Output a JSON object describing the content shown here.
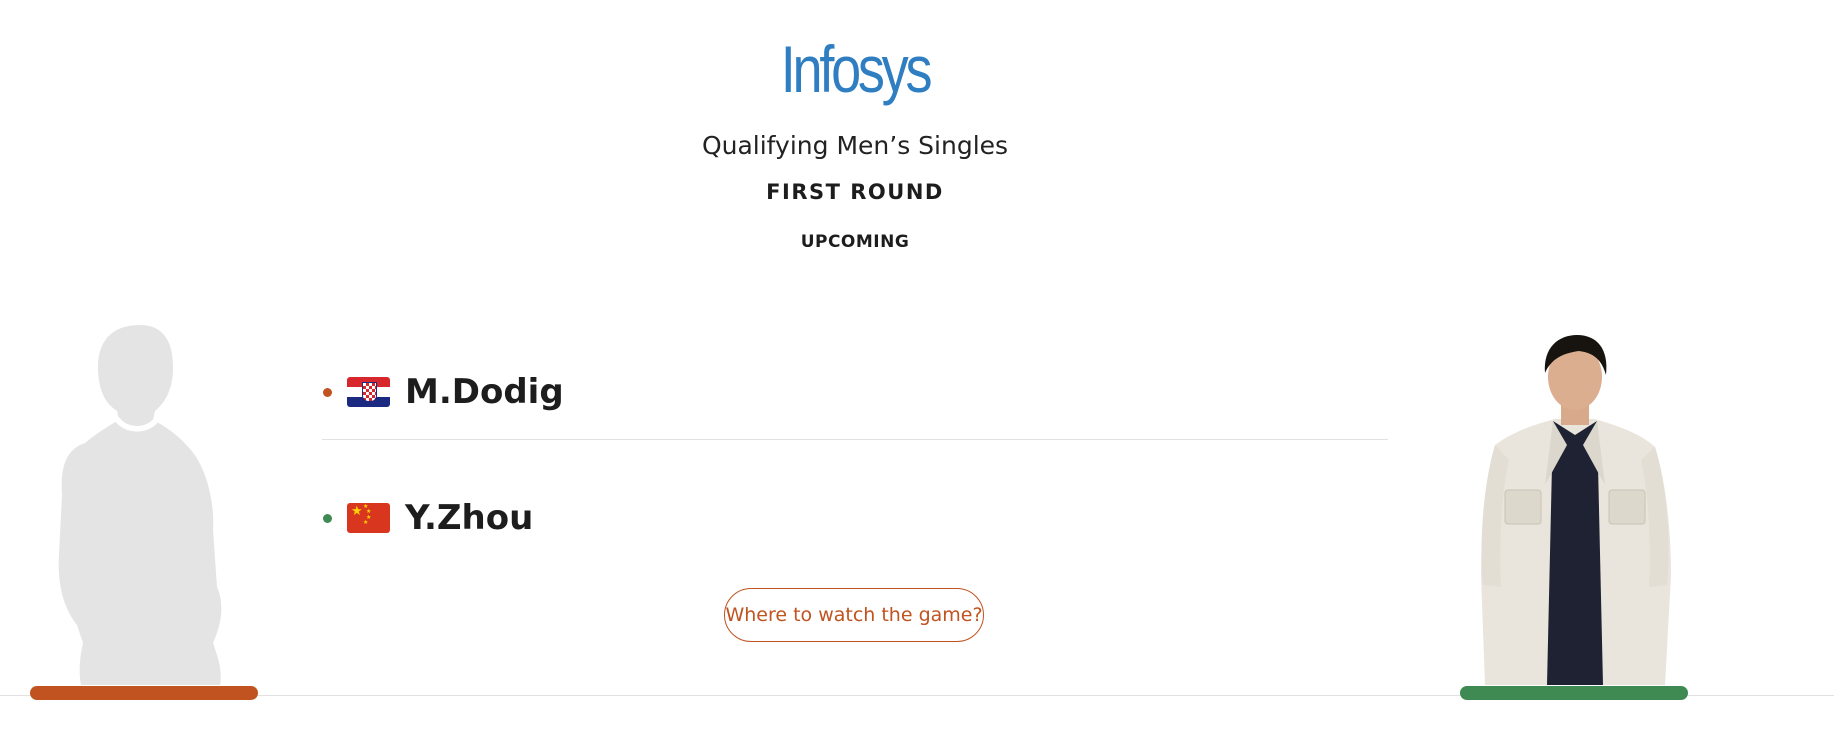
{
  "sponsor": {
    "logo_text": "Infosys",
    "logo_color": "#2f7ec1"
  },
  "match": {
    "event": "Qualifying Men’s Singles",
    "round": "FIRST ROUND",
    "status": "UPCOMING"
  },
  "players": [
    {
      "name": "M.Dodig",
      "country_flag": "croatia-flag",
      "dot_color": "#c0531f",
      "bar_color": "#c0531f"
    },
    {
      "name": "Y.Zhou",
      "country_flag": "china-flag",
      "dot_color": "#3f8a52",
      "bar_color": "#3f8a52"
    }
  ],
  "actions": {
    "watch_label": "Where to watch the game?"
  },
  "colors": {
    "accent": "#c0531f",
    "secondary": "#3f8a52",
    "silhouette": "#e4e4e4"
  }
}
